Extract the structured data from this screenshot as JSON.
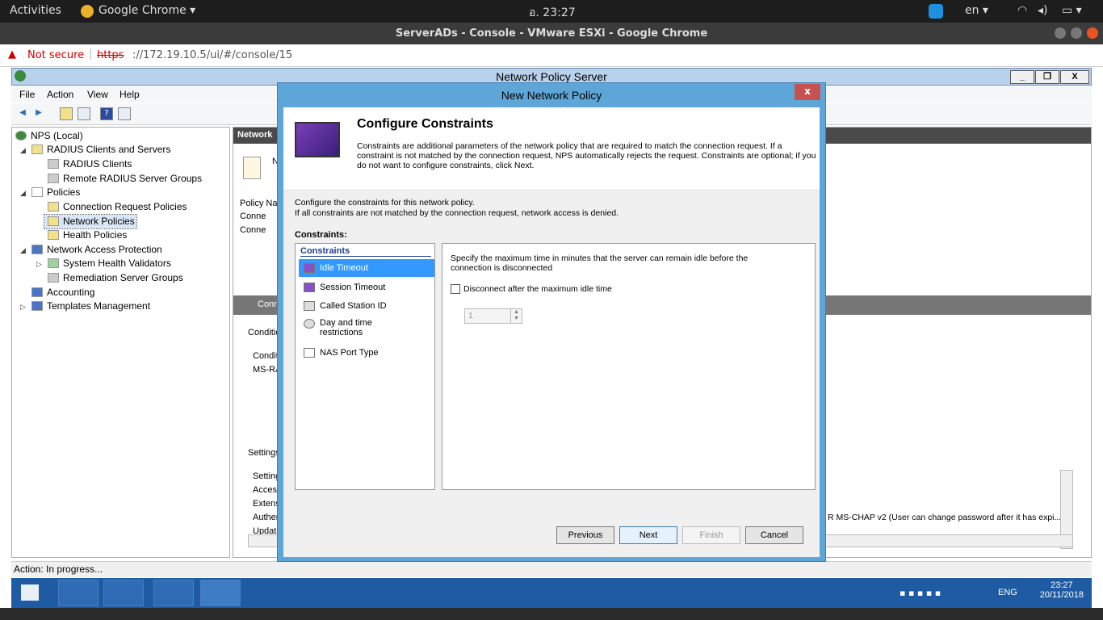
{
  "ubuntu": {
    "activities": "Activities",
    "app_menu": "Google Chrome ▾",
    "clock": "อ. 23:27",
    "lang": "en ▾"
  },
  "chrome": {
    "title": "ServerADs - Console - VMware ESXi - Google Chrome",
    "not_secure": "Not secure",
    "url_scheme": "https",
    "url_rest": "://172.19.10.5/ui/#/console/15"
  },
  "nps": {
    "title": "Network Policy Server",
    "menu": [
      "File",
      "Action",
      "View",
      "Help"
    ],
    "tree": [
      {
        "label": "NPS (Local)"
      },
      {
        "label": "RADIUS Clients and Servers"
      },
      {
        "label": "RADIUS Clients"
      },
      {
        "label": "Remote RADIUS Server Groups"
      },
      {
        "label": "Policies"
      },
      {
        "label": "Connection Request Policies"
      },
      {
        "label": "Network Policies"
      },
      {
        "label": "Health Policies"
      },
      {
        "label": "Network Access Protection"
      },
      {
        "label": "System Health Validators"
      },
      {
        "label": "Remediation Server Groups"
      },
      {
        "label": "Accounting"
      },
      {
        "label": "Templates Management"
      }
    ],
    "right": {
      "header": "Network",
      "n_label": "N",
      "policy_name_col": "Policy Nar",
      "row1": "Conne",
      "row2": "Conne",
      "section2": "Conn",
      "conditions": "Conditio",
      "cond_col": "Conditi",
      "cond_val": "MS-RA",
      "settings": "Settings",
      "settings_rows": [
        "Setting",
        "Acces",
        "Extens",
        "Authen",
        "Updat"
      ],
      "auth_text": "R MS-CHAP v2 (User can change password after it has expi..."
    },
    "status": "Action:  In progress..."
  },
  "taskbar": {
    "lang": "ENG",
    "time": "23:27",
    "date": "20/11/2018"
  },
  "dialog": {
    "title": "New Network Policy",
    "close": "x",
    "heading": "Configure Constraints",
    "description": "Constraints are additional parameters of the network policy that are required to match the connection request. If a constraint is not matched by the connection request, NPS automatically rejects the request. Constraints are optional; if you do not want to configure constraints, click Next.",
    "intro1": "Configure the constraints for this network policy.",
    "intro2": "If all constraints are not matched by the connection request, network access is denied.",
    "constraints_label": "Constraints:",
    "list_header": "Constraints",
    "items": [
      {
        "label": "Idle Timeout"
      },
      {
        "label": "Session Timeout"
      },
      {
        "label": "Called Station ID"
      },
      {
        "label": "Day and time restrictions"
      },
      {
        "label": "NAS Port Type"
      }
    ],
    "panel_text": "Specify the maximum time in minutes that the server can remain idle before the connection is disconnected",
    "checkbox_label": "Disconnect after the maximum idle time",
    "checkbox_checked": false,
    "spinner_value": "1",
    "buttons": {
      "previous": "Previous",
      "next": "Next",
      "finish": "Finish",
      "cancel": "Cancel"
    }
  }
}
